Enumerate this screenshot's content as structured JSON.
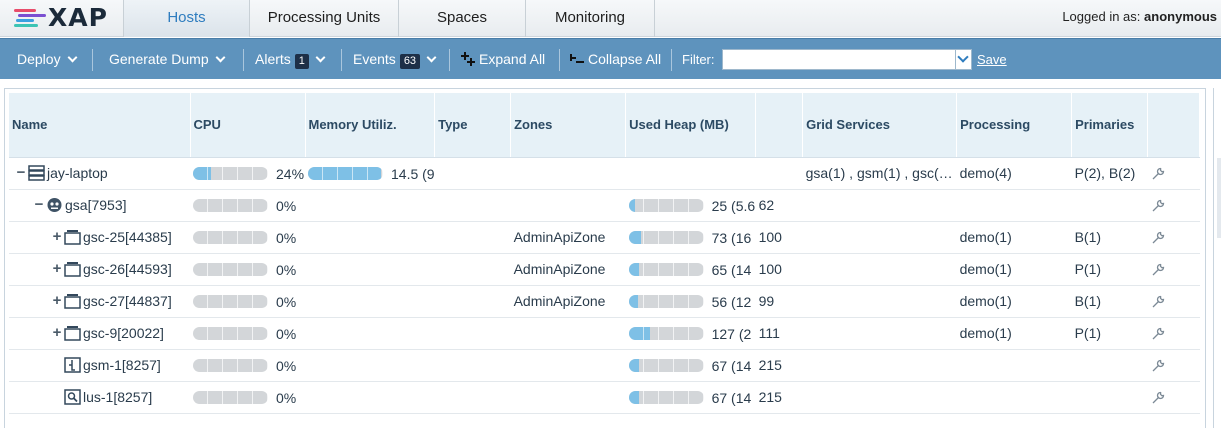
{
  "app": {
    "logo_text": "XAP",
    "logo_colors": [
      "#e84d6b",
      "#7a4fd1",
      "#3aa0e0",
      "#3cc4b4"
    ]
  },
  "nav": {
    "tabs": [
      {
        "label": "Hosts",
        "active": true
      },
      {
        "label": "Processing Units",
        "active": false
      },
      {
        "label": "Spaces",
        "active": false
      },
      {
        "label": "Monitoring",
        "active": false
      }
    ],
    "login_prefix": "Logged in as:",
    "login_user": "anonymous"
  },
  "toolbar": {
    "deploy": "Deploy",
    "generate_dump": "Generate Dump",
    "alerts": "Alerts",
    "alerts_count": "1",
    "events": "Events",
    "events_count": "63",
    "expand_all": "Expand All",
    "collapse_all": "Collapse All",
    "filter_label": "Filter:",
    "filter_value": "",
    "save": "Save"
  },
  "table": {
    "columns": [
      "Name",
      "CPU",
      "Memory Utiliz.",
      "Type",
      "Zones",
      "Used Heap (MB)",
      "",
      "Grid Services",
      "Processing",
      "Primaries",
      ""
    ],
    "rows": [
      {
        "toggle": "−",
        "indent": 0,
        "icon": "server-icon",
        "name": "jay-laptop",
        "cpu_pct": 24,
        "cpu": "24%",
        "mem_pct": 97,
        "mem": "14.5 (9",
        "type": "",
        "zones": "",
        "heap_pct": null,
        "heap": "",
        "heap_extra": "",
        "grid_services": "gsa(1) , gsm(1) , gsc(…",
        "processing": "demo(4)",
        "primaries": "P(2), B(2)"
      },
      {
        "toggle": "−",
        "indent": 1,
        "icon": "agent-icon",
        "name": "gsa[7953]",
        "cpu_pct": 0,
        "cpu": "0%",
        "mem_pct": null,
        "mem": "",
        "type": "",
        "zones": "",
        "heap_pct": 8,
        "heap": "25 (5.6",
        "heap_extra": "62",
        "grid_services": "",
        "processing": "",
        "primaries": ""
      },
      {
        "toggle": "+",
        "indent": 2,
        "icon": "container-icon",
        "name": "gsc-25[44385]",
        "cpu_pct": 0,
        "cpu": "0%",
        "mem_pct": null,
        "mem": "",
        "type": "",
        "zones": "AdminApiZone",
        "heap_pct": 17,
        "heap": "73 (16",
        "heap_extra": "100",
        "grid_services": "",
        "processing": "demo(1)",
        "primaries": "B(1)"
      },
      {
        "toggle": "+",
        "indent": 2,
        "icon": "container-icon",
        "name": "gsc-26[44593]",
        "cpu_pct": 0,
        "cpu": "0%",
        "mem_pct": null,
        "mem": "",
        "type": "",
        "zones": "AdminApiZone",
        "heap_pct": 14,
        "heap": "65 (14",
        "heap_extra": "100",
        "grid_services": "",
        "processing": "demo(1)",
        "primaries": "P(1)"
      },
      {
        "toggle": "+",
        "indent": 2,
        "icon": "container-icon",
        "name": "gsc-27[44837]",
        "cpu_pct": 0,
        "cpu": "0%",
        "mem_pct": null,
        "mem": "",
        "type": "",
        "zones": "AdminApiZone",
        "heap_pct": 12,
        "heap": "56 (12",
        "heap_extra": "99",
        "grid_services": "",
        "processing": "demo(1)",
        "primaries": "B(1)"
      },
      {
        "toggle": "+",
        "indent": 2,
        "icon": "container-icon",
        "name": "gsc-9[20022]",
        "cpu_pct": 0,
        "cpu": "0%",
        "mem_pct": null,
        "mem": "",
        "type": "",
        "zones": "",
        "heap_pct": 28,
        "heap": "127 (2",
        "heap_extra": "111",
        "grid_services": "",
        "processing": "demo(1)",
        "primaries": "P(1)"
      },
      {
        "toggle": "",
        "indent": 2,
        "icon": "manager-icon",
        "name": "gsm-1[8257]",
        "cpu_pct": 0,
        "cpu": "0%",
        "mem_pct": null,
        "mem": "",
        "type": "",
        "zones": "",
        "heap_pct": 14,
        "heap": "67 (14",
        "heap_extra": "215",
        "grid_services": "",
        "processing": "",
        "primaries": ""
      },
      {
        "toggle": "",
        "indent": 2,
        "icon": "lookup-icon",
        "name": "lus-1[8257]",
        "cpu_pct": 0,
        "cpu": "0%",
        "mem_pct": null,
        "mem": "",
        "type": "",
        "zones": "",
        "heap_pct": 14,
        "heap": "67 (14",
        "heap_extra": "215",
        "grid_services": "",
        "processing": "",
        "primaries": ""
      }
    ]
  }
}
